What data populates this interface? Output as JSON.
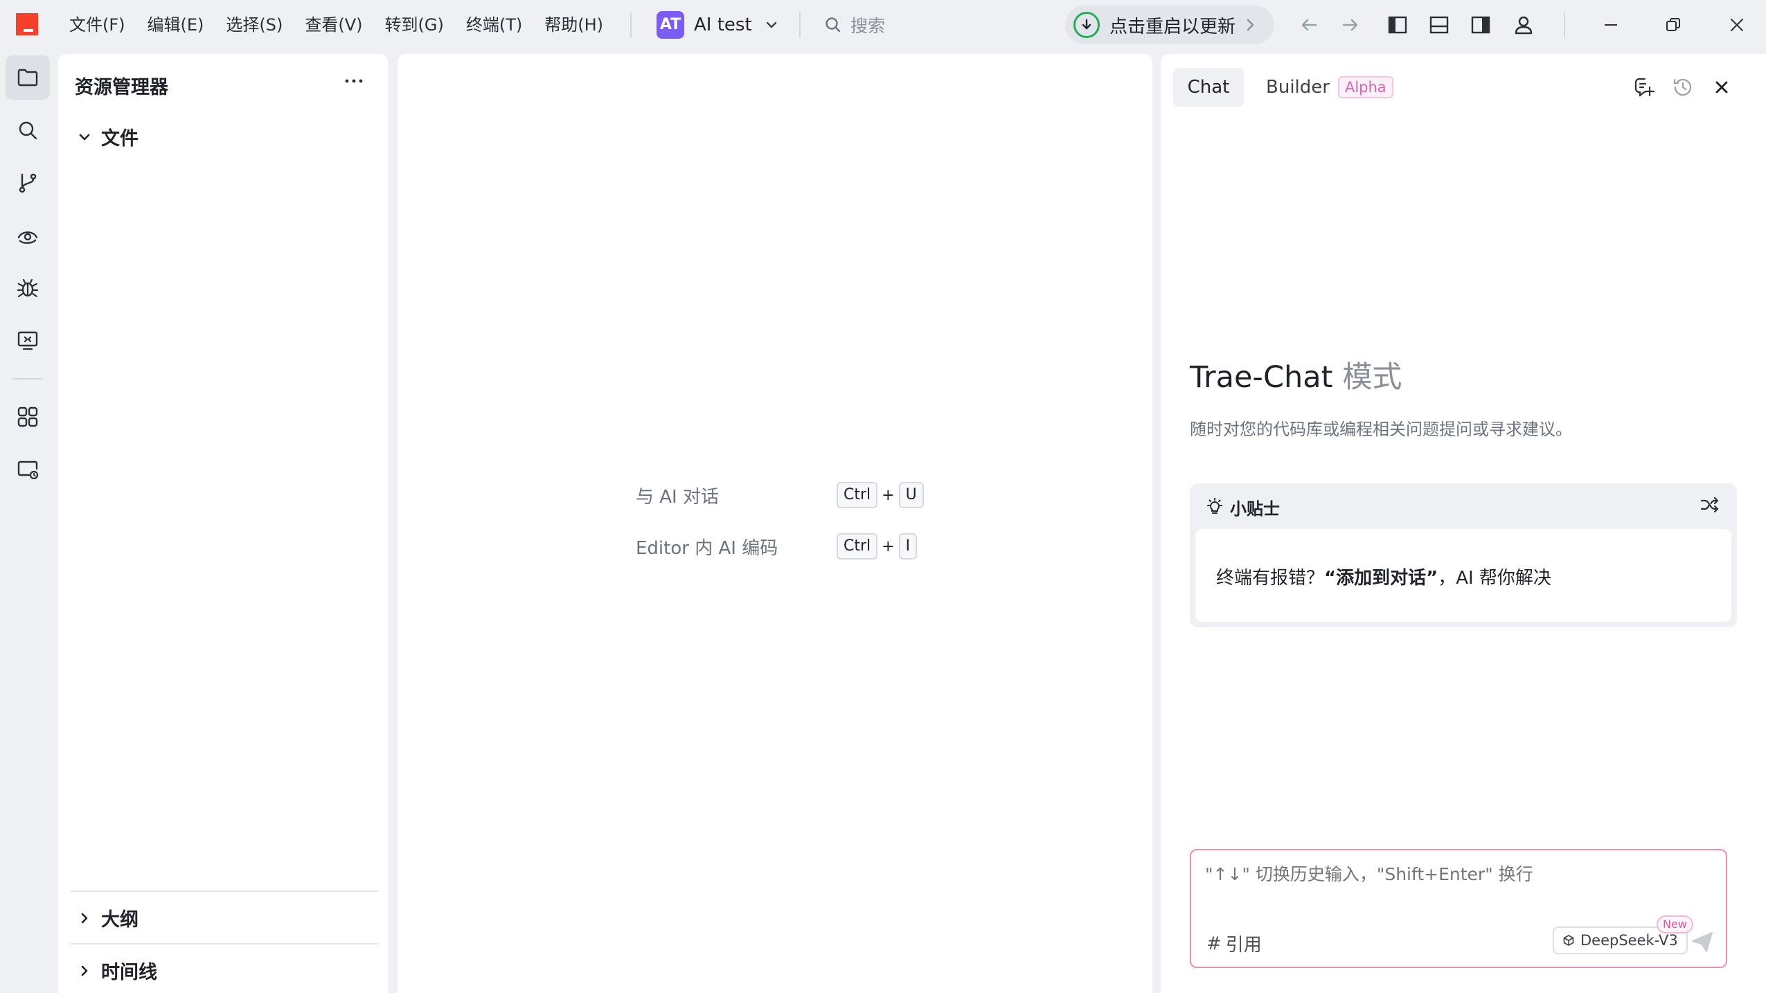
{
  "menu": {
    "items": [
      "文件(F)",
      "编辑(E)",
      "选择(S)",
      "查看(V)",
      "转到(G)",
      "终端(T)",
      "帮助(H)"
    ]
  },
  "project": {
    "badge": "AT",
    "name": "AI test",
    "badge_color": "#7b5cf5"
  },
  "search": {
    "placeholder": "搜索"
  },
  "update": {
    "label": "点击重启以更新",
    "accent": "#1eae56"
  },
  "titlebar_icons": [
    "back-arrow-icon",
    "forward-arrow-icon",
    "toggle-sidebar-icon",
    "toggle-panel-icon",
    "toggle-secondary-sidebar-icon",
    "account-icon",
    "minimize-icon",
    "restore-icon",
    "close-icon"
  ],
  "activitybar": {
    "items": [
      "explorer-icon",
      "search-icon",
      "source-control-icon",
      "ai-vision-icon",
      "debug-icon",
      "remote-explorer-icon",
      "extensions-icon",
      "remote-monitor-icon"
    ]
  },
  "explorer": {
    "title": "资源管理器",
    "files_section": "文件",
    "outline_section": "大纲",
    "timeline_section": "时间线"
  },
  "editor": {
    "hints": [
      {
        "label": "与 AI 对话",
        "keys": [
          "Ctrl",
          "U"
        ]
      },
      {
        "label": "Editor 内 AI 编码",
        "keys": [
          "Ctrl",
          "I"
        ]
      }
    ]
  },
  "chat": {
    "tabs": {
      "chat": "Chat",
      "builder": "Builder",
      "builder_badge": "Alpha"
    },
    "title_main": "Trae-Chat",
    "title_sub": "模式",
    "description": "随时对您的代码库或编程相关问题提问或寻求建议。",
    "tips": {
      "title": "小贴士",
      "text_before": "终端有报错？",
      "text_bold": "“添加到对话”",
      "text_after": "，AI 帮你解决"
    },
    "input": {
      "placeholder": "\"↑↓\" 切换历史输入，\"Shift+Enter\" 换行",
      "reference_symbol": "#",
      "reference_label": "引用",
      "model": "DeepSeek-V3",
      "model_badge": "New"
    }
  }
}
